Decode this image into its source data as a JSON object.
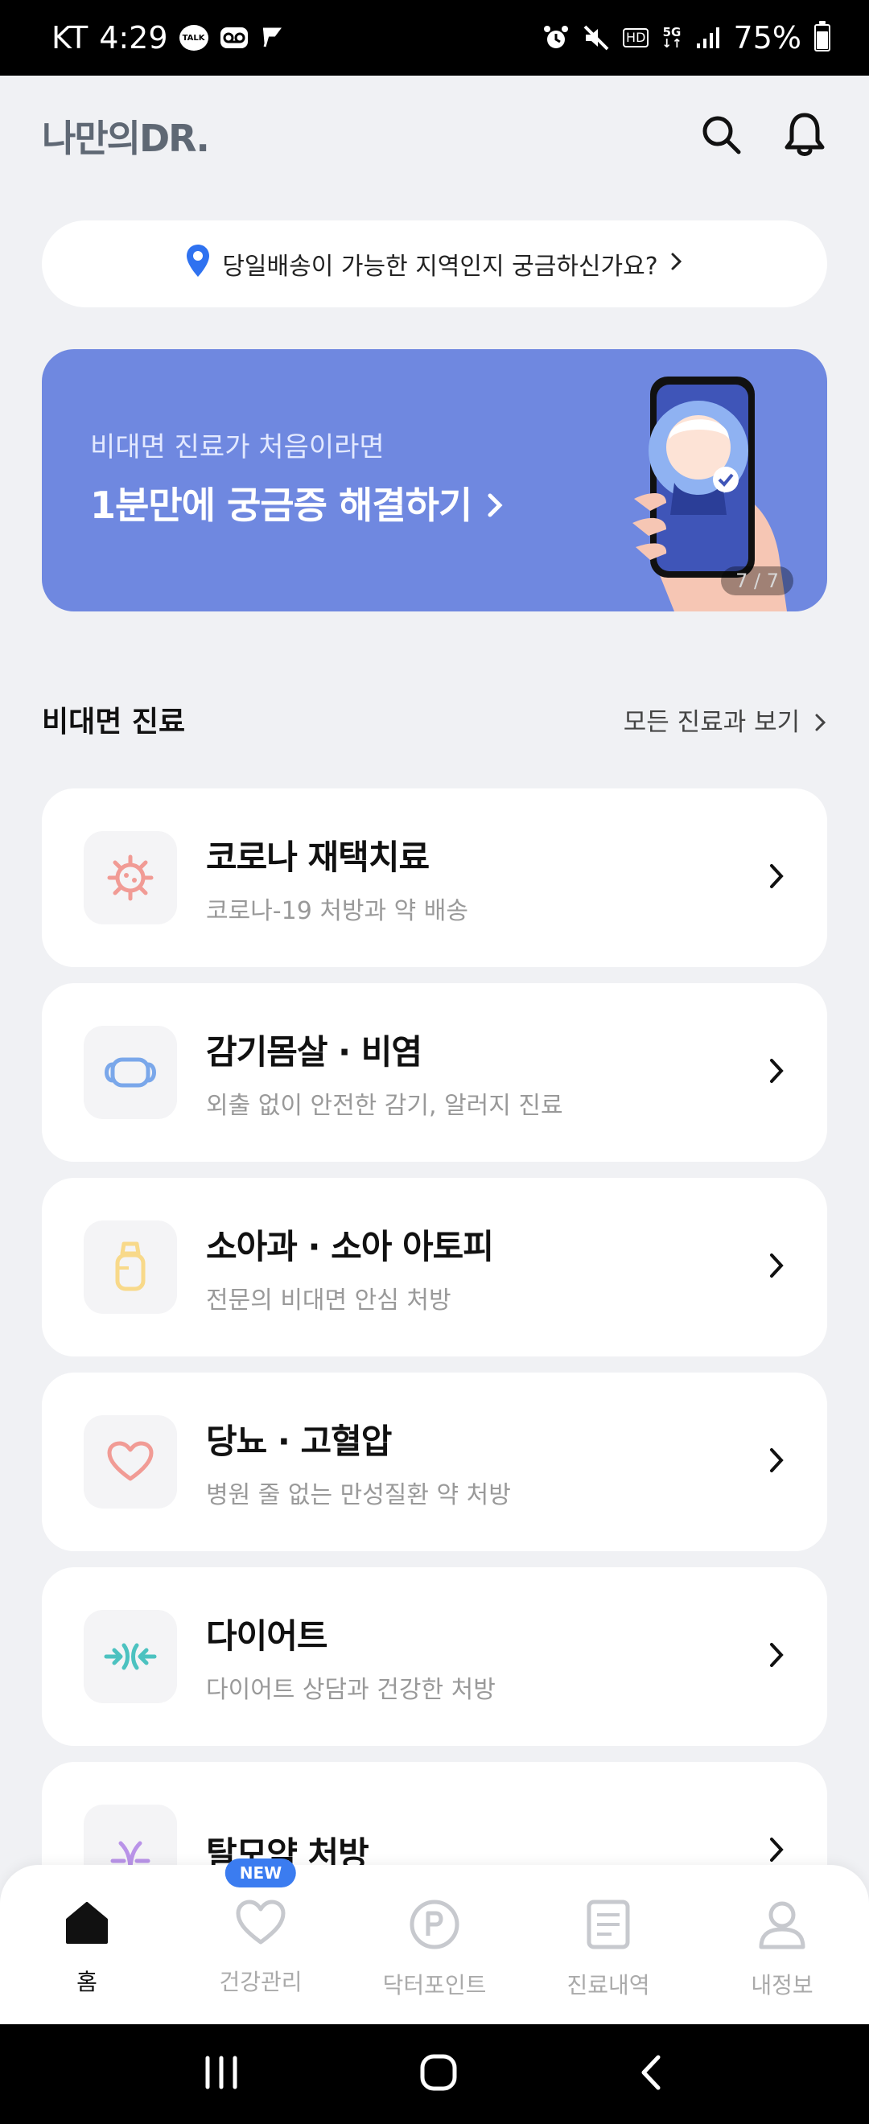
{
  "status_bar": {
    "carrier": "KT",
    "time": "4:29",
    "battery": "75%",
    "battery_level": 0.75
  },
  "header": {
    "logo": "나만의DR.",
    "icons": [
      "search-icon",
      "bell-icon"
    ]
  },
  "delivery_banner": {
    "text": "당일배송이 가능한 지역인지 궁금하신가요?"
  },
  "promo": {
    "subtitle": "비대면 진료가 처음이라면",
    "title": "1분만에 궁금증 해결하기",
    "page": "7 / 7"
  },
  "section": {
    "title": "비대면 진료",
    "link": "모든 진료과 보기"
  },
  "treatments": [
    {
      "title": "코로나 재택치료",
      "desc": "코로나-19 처방과 약 배송",
      "icon": "virus-icon"
    },
    {
      "title": "감기몸살 · 비염",
      "desc": "외출 없이 안전한 감기, 알러지 진료",
      "icon": "mask-icon"
    },
    {
      "title": "소아과 · 소아 아토피",
      "desc": "전문의 비대면 안심 처방",
      "icon": "baby-bottle-icon"
    },
    {
      "title": "당뇨 · 고혈압",
      "desc": "병원 줄 없는 만성질환 약 처방",
      "icon": "heart-icon"
    },
    {
      "title": "다이어트",
      "desc": "다이어트 상담과 건강한 처방",
      "icon": "diet-icon"
    },
    {
      "title": "탈모약 처방",
      "desc": "",
      "icon": "hair-icon"
    }
  ],
  "bottom_nav": [
    {
      "label": "홈",
      "icon": "home-icon"
    },
    {
      "label": "건강관리",
      "icon": "heart-outline-icon",
      "badge": "NEW"
    },
    {
      "label": "닥터포인트",
      "icon": "point-icon"
    },
    {
      "label": "진료내역",
      "icon": "document-icon"
    },
    {
      "label": "내정보",
      "icon": "person-icon"
    }
  ],
  "colors": {
    "background": "#f0f1f4",
    "banner": "#6f88e0",
    "accent_blue": "#3b7cf0"
  }
}
